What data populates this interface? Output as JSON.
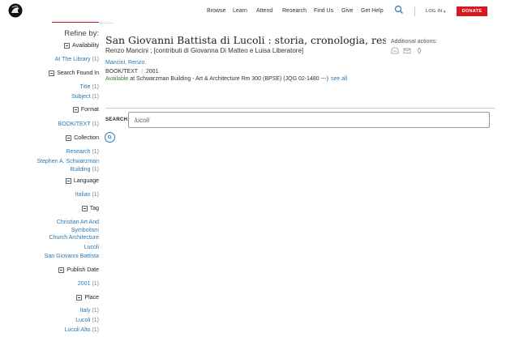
{
  "header": {
    "nav": [
      "Browse",
      "Learn",
      "Attend",
      "Research",
      "Find Us",
      "Give",
      "Get Help"
    ],
    "login_label": "LOG IN",
    "donate_label": "DONATE"
  },
  "sidebar": {
    "title": "Refine by:",
    "facets": [
      {
        "name": "Availability",
        "items": [
          {
            "label": "At The Library",
            "count": "(1)"
          }
        ]
      },
      {
        "name": "Search Found In",
        "items": [
          {
            "label": "Title",
            "count": "(1)"
          },
          {
            "label": "Subject",
            "count": "(1)"
          }
        ]
      },
      {
        "name": "Format",
        "items": [
          {
            "label": "BOOK/TEXT",
            "count": "(1)"
          }
        ]
      },
      {
        "name": "Collection",
        "items": [
          {
            "label": "Research",
            "count": "(1)"
          },
          {
            "label": "Stephen A. Schwarzman",
            "label2": "Building",
            "count": "(1)"
          }
        ]
      },
      {
        "name": "Language",
        "items": [
          {
            "label": "Italian",
            "count": "(1)"
          }
        ]
      },
      {
        "name": "Tag",
        "items": [
          {
            "label": "Christian Art And",
            "label2": "Symbolism"
          },
          {
            "label": "Church Architecture"
          },
          {
            "label": "Lucoli"
          },
          {
            "label": "San Giovanni Battista"
          }
        ]
      },
      {
        "name": "Publish Date",
        "items": [
          {
            "label": "2001",
            "count": "(1)"
          }
        ]
      },
      {
        "name": "Place",
        "items": [
          {
            "label": "Italy",
            "count": "(1)"
          },
          {
            "label": "Lucoli",
            "count": "(1)"
          },
          {
            "label": "Lucoli Alto",
            "count": "(1)"
          }
        ]
      }
    ]
  },
  "record": {
    "title": "San Giovanni Battista di Lucoli : storia, cronologia, restauro /",
    "responsibility": "Renzo Mancini ; [contributi di Giovanna Di Matteo e Luisa Liberatore]",
    "author": "Mancini, Renzo.",
    "format": "BOOK/TEXT",
    "year": "2001",
    "availability_status": "Available",
    "availability_location": " at Schwarzman Building - Art & Architecture Rm 300 (BPSE) (JQG 02-1480 ---)",
    "see_all": "see all"
  },
  "additional_actions": {
    "label": "Additional actions:",
    "icons": [
      "bookmark-icon",
      "email-icon",
      "pin-icon"
    ]
  },
  "search": {
    "label": "SEARCH:",
    "value": "lucoli"
  },
  "colors": {
    "link": "#2b79b4",
    "brand_red": "#d71920",
    "available_green": "#3a7d3a"
  }
}
